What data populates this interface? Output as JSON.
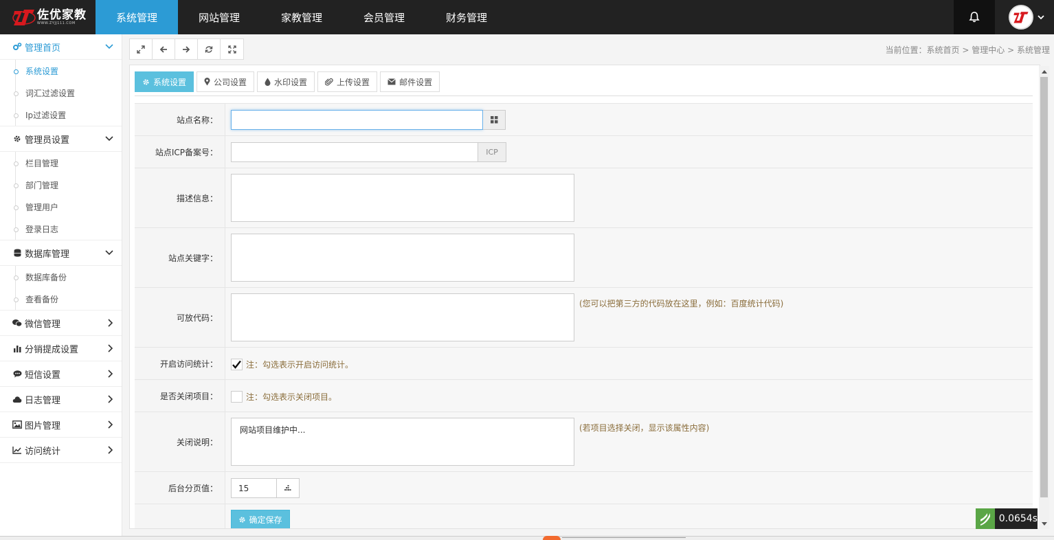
{
  "app": {
    "logo_title": "佐优家教",
    "logo_sub": "WWW.ZYJJ111.COM",
    "brand_color": "#2c9bd5",
    "brand_red": "#d7191e"
  },
  "topnav": {
    "items": [
      {
        "label": "系统管理",
        "active": true
      },
      {
        "label": "网站管理",
        "active": false
      },
      {
        "label": "家教管理",
        "active": false
      },
      {
        "label": "会员管理",
        "active": false
      },
      {
        "label": "财务管理",
        "active": false
      }
    ],
    "bell_icon": "bell-icon",
    "user_icon": "avatar-logo"
  },
  "sidebar": {
    "groups": [
      {
        "label": "管理首页",
        "icon": "gears-icon",
        "expanded": true,
        "active": true,
        "items": [
          "系统设置",
          "词汇过滤设置",
          "Ip过滤设置"
        ],
        "active_item": 0
      },
      {
        "label": "管理员设置",
        "icon": "gear-icon",
        "expanded": true,
        "items": [
          "栏目管理",
          "部门管理",
          "管理用户",
          "登录日志"
        ]
      },
      {
        "label": "数据库管理",
        "icon": "database-icon",
        "expanded": true,
        "items": [
          "数据库备份",
          "查看备份"
        ]
      },
      {
        "label": "微信管理",
        "icon": "wechat-icon",
        "expanded": false,
        "items": []
      },
      {
        "label": "分销提成设置",
        "icon": "bar-chart-icon",
        "expanded": false,
        "items": []
      },
      {
        "label": "短信设置",
        "icon": "comment-icon",
        "expanded": false,
        "items": []
      },
      {
        "label": "日志管理",
        "icon": "cloud-icon",
        "expanded": false,
        "items": []
      },
      {
        "label": "图片管理",
        "icon": "picture-icon",
        "expanded": false,
        "items": []
      },
      {
        "label": "访问统计",
        "icon": "line-chart-icon",
        "expanded": false,
        "items": []
      }
    ]
  },
  "toolbar": {
    "buttons": [
      "expand-icon",
      "arrow-left-icon",
      "arrow-right-icon",
      "refresh-icon",
      "fullscreen-icon"
    ]
  },
  "breadcrumb": {
    "prefix": "当前位置：",
    "items": [
      "系统首页",
      "管理中心",
      "系统管理"
    ],
    "separator": ">"
  },
  "tabs": [
    {
      "label": "系统设置",
      "icon": "gear-icon",
      "active": true
    },
    {
      "label": "公司设置",
      "icon": "map-marker-icon",
      "active": false
    },
    {
      "label": "水印设置",
      "icon": "tint-icon",
      "active": false
    },
    {
      "label": "上传设置",
      "icon": "paperclip-icon",
      "active": false
    },
    {
      "label": "邮件设置",
      "icon": "envelope-icon",
      "active": false
    }
  ],
  "form": {
    "site_name": {
      "label": "站点名称：",
      "value": "",
      "addon": "grid-icon"
    },
    "icp": {
      "label": "站点ICP备案号：",
      "value": "",
      "addon": "ICP"
    },
    "description": {
      "label": "描述信息：",
      "value": ""
    },
    "keywords": {
      "label": "站点关键字：",
      "value": ""
    },
    "code": {
      "label": "可放代码：",
      "value": "",
      "hint": "(您可以把第三方的代码放在这里，例如：百度统计代码)"
    },
    "stats": {
      "label": "开启访问统计：",
      "checked": true,
      "note": "注：勾选表示开启访问统计。"
    },
    "close": {
      "label": "是否关闭项目：",
      "checked": false,
      "note": "注：勾选表示关闭项目。"
    },
    "close_desc": {
      "label": "关闭说明：",
      "value": "网站项目维护中...",
      "hint": "(若项目选择关闭，显示该属性内容)"
    },
    "page_size": {
      "label": "后台分页值：",
      "value": "15",
      "addon": "sort-icon"
    },
    "save_label": "确定保存"
  },
  "timer": {
    "value": "0.0654s"
  }
}
